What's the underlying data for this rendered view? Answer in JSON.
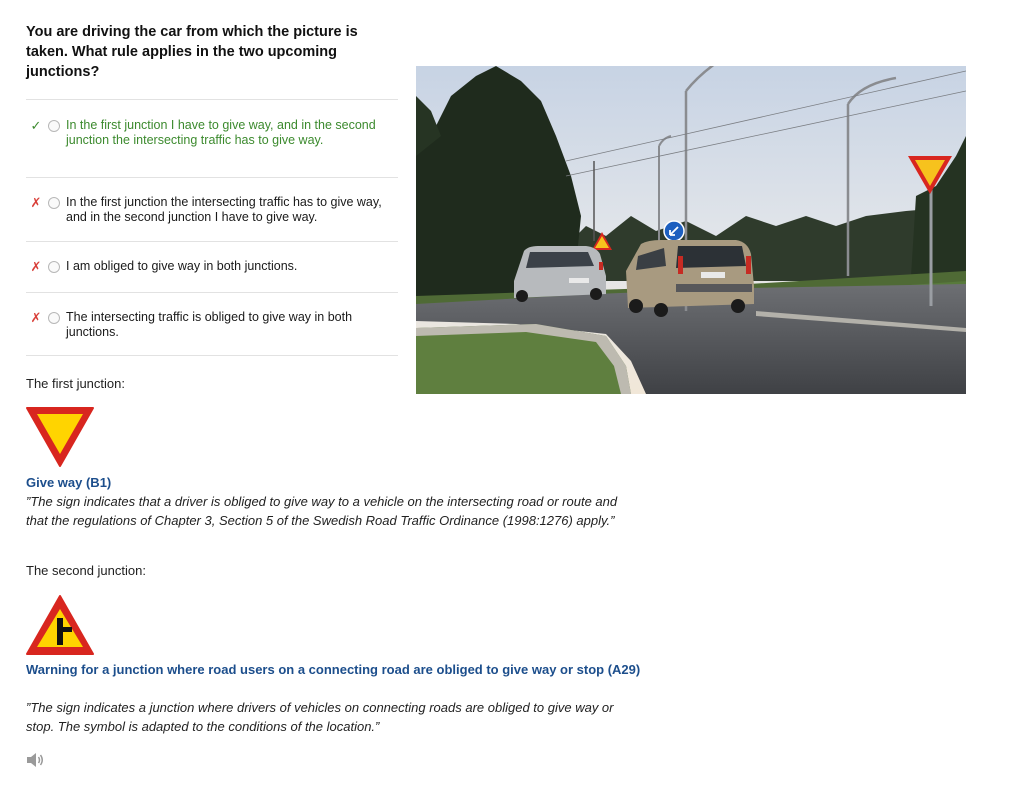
{
  "question": {
    "text": "You are driving the car from which the picture is taken. What rule applies in the two upcoming junctions?"
  },
  "answers": [
    {
      "mark": "✓",
      "status": "correct",
      "text": "In the first junction I have to give way, and in the second junction the intersecting traffic has to give way."
    },
    {
      "mark": "✗",
      "status": "incorrect",
      "text": "In the first junction the intersecting traffic has to give way, and in the second junction I have to give way."
    },
    {
      "mark": "✗",
      "status": "incorrect",
      "text": "I am obliged to give way in both junctions."
    },
    {
      "mark": "✗",
      "status": "incorrect",
      "text": "The intersecting traffic is obliged to give way in both junctions."
    }
  ],
  "explanation": {
    "first_label": "The first junction:",
    "first_sign_title": "Give way (B1)",
    "first_sign_quote": "”The sign indicates that a driver is obliged to give way to a vehicle on the intersecting road or route and that the regulations of Chapter 3, Section 5 of the Swedish Road Traffic Ordinance (1998:1276) apply.”",
    "second_label": "The second junction:",
    "second_sign_title": "Warning for a junction where road users on a connecting road are obliged to give way or stop (A29)",
    "second_sign_quote": "”The sign indicates a junction where drivers of vehicles on connecting roads are obliged to give way or stop. The symbol is adapted to the conditions of the location.”"
  },
  "icons": {
    "correct": "check-icon",
    "incorrect": "cross-icon",
    "audio": "speaker-icon"
  },
  "colors": {
    "correct": "#3c8a2e",
    "incorrect": "#d9403a",
    "link_blue": "#1c4e8c",
    "sign_red": "#d8261f",
    "sign_yellow": "#ffd400"
  }
}
